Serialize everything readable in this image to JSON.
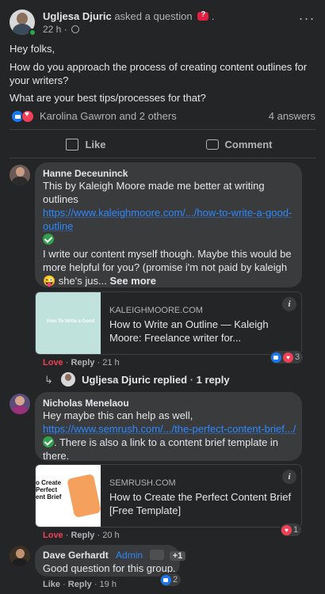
{
  "post": {
    "author": "Ugljesa Djuric",
    "action": "asked a question",
    "time": "22 h",
    "dot": "·",
    "greeting": "Hey folks,",
    "question": "How do you approach the process of creating content outlines for your writers?",
    "followup": "What are your best tips/processes for that?",
    "reactions_text": "Karolina Gawron and 2 others",
    "answers": "4 answers",
    "like_label": "Like",
    "comment_label": "Comment"
  },
  "comments": [
    {
      "name": "Hanne Deceuninck",
      "text1": "This by Kaleigh Moore made me better at writing outlines",
      "link": "https://www.kaleighmoore.com/.../how-to-write-a-good-outline",
      "text2": "I write our content myself though. Maybe this would be more helpful for you? (promise i'm not paid by kaleigh 😜 she's jus...",
      "see_more": "See more",
      "preview_domain": "KALEIGHMOORE.COM",
      "preview_title": "How to Write an Outline — Kaleigh Moore: Freelance writer for...",
      "preview_thumb_text": "How To Write a Good",
      "love": "Love",
      "reply": "Reply",
      "time": "21 h",
      "react_count": "3",
      "replied_by": "Ugljesa Djuric replied",
      "reply_count": "1 reply"
    },
    {
      "name": "Nicholas Menelaou",
      "text1": "Hey maybe this can help as well,",
      "link": "https://www.semrush.com/.../the-perfect-content-brief.../",
      "text2": ". There is also a link to a content brief template in there.",
      "preview_domain": "SEMRUSH.COM",
      "preview_title": "How to Create the Perfect Content Brief [Free Template]",
      "preview_thumb_text": "o Create Perfect ent Brief",
      "love": "Love",
      "reply": "Reply",
      "time": "20 h",
      "react_count": "1"
    },
    {
      "name": "Dave Gerhardt",
      "admin": "Admin",
      "plus": "+1",
      "text1": "Good question for this group.",
      "like": "Like",
      "reply": "Reply",
      "time": "19 h",
      "react_count": "2"
    }
  ],
  "icons": {
    "more": "more-icon",
    "globe": "globe-icon",
    "like": "thumb-icon",
    "comment": "comment-icon",
    "info": "info-icon",
    "check": "check-icon"
  },
  "colors": {
    "bg": "#242526",
    "bubble": "#3a3b3c",
    "link": "#2d88ff",
    "love": "#f33e58",
    "like": "#1877f2",
    "online": "#31a24c"
  }
}
